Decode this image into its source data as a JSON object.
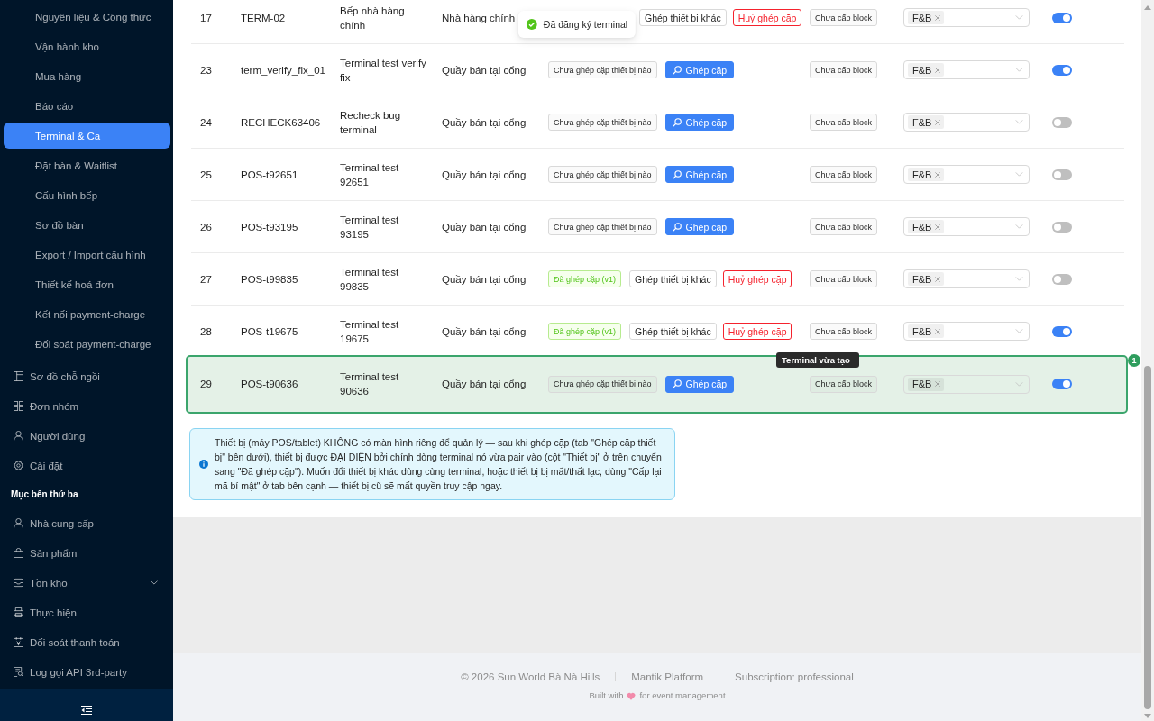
{
  "sidebar": {
    "items": [
      {
        "kind": "subitem",
        "label": "Nguyên liệu & Công thức",
        "selected": false
      },
      {
        "kind": "subitem",
        "label": "Vận hành kho",
        "selected": false
      },
      {
        "kind": "subitem",
        "label": "Mua hàng",
        "selected": false
      },
      {
        "kind": "subitem",
        "label": "Báo cáo",
        "selected": false
      },
      {
        "kind": "subitem",
        "label": "Terminal & Ca",
        "selected": true
      },
      {
        "kind": "subitem",
        "label": "Đặt bàn & Waitlist",
        "selected": false
      },
      {
        "kind": "subitem",
        "label": "Cấu hình bếp",
        "selected": false
      },
      {
        "kind": "subitem",
        "label": "Sơ đồ bàn",
        "selected": false
      },
      {
        "kind": "subitem",
        "label": "Export / Import cấu hình",
        "selected": false
      },
      {
        "kind": "subitem",
        "label": "Thiết kế hoá đơn",
        "selected": false
      },
      {
        "kind": "subitem",
        "label": "Kết nối payment-charge",
        "selected": false
      },
      {
        "kind": "subitem",
        "label": "Đối soát payment-charge",
        "selected": false
      },
      {
        "kind": "item",
        "label": "Sơ đồ chỗ ngồi",
        "selected": false
      },
      {
        "kind": "item",
        "label": "Đơn nhóm",
        "selected": false
      },
      {
        "kind": "item",
        "label": "Người dùng",
        "selected": false
      },
      {
        "kind": "item",
        "label": "Cài đặt",
        "selected": false
      },
      {
        "kind": "heading",
        "label": "Mục bên thứ ba"
      },
      {
        "kind": "item",
        "label": "Nhà cung cấp",
        "selected": false
      },
      {
        "kind": "item",
        "label": "Sản phẩm",
        "selected": false
      },
      {
        "kind": "item",
        "label": "Tồn kho",
        "selected": false,
        "expanded": false
      },
      {
        "kind": "item",
        "label": "Thực hiện",
        "selected": false
      },
      {
        "kind": "item",
        "label": "Đối soát thanh toán",
        "selected": false
      },
      {
        "kind": "item",
        "label": "Log gọi API 3rd-party",
        "selected": false
      }
    ]
  },
  "toast": {
    "kind": "success",
    "message": "Đã đăng ký terminal"
  },
  "table": {
    "rows": [
      {
        "no": "17",
        "code": "TERM-02",
        "name": "Bếp nhà hàng chính",
        "location": "Nhà hàng chính",
        "device": {
          "actions": [
            {
              "kind": "pair_other",
              "label": "Ghép thiết bị khác"
            },
            {
              "kind": "unpair",
              "label": "Huỷ ghép cặp"
            }
          ]
        },
        "block": "Chưa cấp block",
        "types": [
          "F&B"
        ],
        "active": true,
        "highlighted": false
      },
      {
        "no": "23",
        "code": "term_verify_fix_01",
        "name": "Terminal test verify fix",
        "location": "Quầy bán tại cổng",
        "device": {
          "status": {
            "kind": "unpaired",
            "label": "Chưa ghép cặp thiết bị nào"
          },
          "actions": [
            {
              "kind": "pair",
              "label": "Ghép cặp"
            }
          ]
        },
        "block": "Chưa cấp block",
        "types": [
          "F&B"
        ],
        "active": true,
        "highlighted": false
      },
      {
        "no": "24",
        "code": "RECHECK63406",
        "name": "Recheck bug terminal",
        "location": "Quầy bán tại cổng",
        "device": {
          "status": {
            "kind": "unpaired",
            "label": "Chưa ghép cặp thiết bị nào"
          },
          "actions": [
            {
              "kind": "pair",
              "label": "Ghép cặp"
            }
          ]
        },
        "block": "Chưa cấp block",
        "types": [
          "F&B"
        ],
        "active": false,
        "highlighted": false
      },
      {
        "no": "25",
        "code": "POS-t92651",
        "name": "Terminal test 92651",
        "location": "Quầy bán tại cổng",
        "device": {
          "status": {
            "kind": "unpaired",
            "label": "Chưa ghép cặp thiết bị nào"
          },
          "actions": [
            {
              "kind": "pair",
              "label": "Ghép cặp"
            }
          ]
        },
        "block": "Chưa cấp block",
        "types": [
          "F&B"
        ],
        "active": false,
        "highlighted": false
      },
      {
        "no": "26",
        "code": "POS-t93195",
        "name": "Terminal test 93195",
        "location": "Quầy bán tại cổng",
        "device": {
          "status": {
            "kind": "unpaired",
            "label": "Chưa ghép cặp thiết bị nào"
          },
          "actions": [
            {
              "kind": "pair",
              "label": "Ghép cặp"
            }
          ]
        },
        "block": "Chưa cấp block",
        "types": [
          "F&B"
        ],
        "active": false,
        "highlighted": false
      },
      {
        "no": "27",
        "code": "POS-t99835",
        "name": "Terminal test 99835",
        "location": "Quầy bán tại cổng",
        "device": {
          "status": {
            "kind": "paired",
            "label": "Đã ghép cặp (v1)"
          },
          "actions": [
            {
              "kind": "pair_other",
              "label": "Ghép thiết bị khác"
            },
            {
              "kind": "unpair",
              "label": "Huỷ ghép cặp"
            }
          ]
        },
        "block": "Chưa cấp block",
        "types": [
          "F&B"
        ],
        "active": false,
        "highlighted": false
      },
      {
        "no": "28",
        "code": "POS-t19675",
        "name": "Terminal test 19675",
        "location": "Quầy bán tại cổng",
        "device": {
          "status": {
            "kind": "paired",
            "label": "Đã ghép cặp (v1)"
          },
          "actions": [
            {
              "kind": "pair_other",
              "label": "Ghép thiết bị khác"
            },
            {
              "kind": "unpair",
              "label": "Huỷ ghép cặp"
            }
          ]
        },
        "block": "Chưa cấp block",
        "types": [
          "F&B"
        ],
        "active": true,
        "highlighted": false
      },
      {
        "no": "29",
        "code": "POS-t90636",
        "name": "Terminal test 90636",
        "location": "Quầy bán tại cổng",
        "device": {
          "status": {
            "kind": "unpaired",
            "label": "Chưa ghép cặp thiết bị nào"
          },
          "actions": [
            {
              "kind": "pair",
              "label": "Ghép cặp"
            }
          ]
        },
        "block": "Chưa cấp block",
        "types": [
          "F&B"
        ],
        "active": true,
        "highlighted": true,
        "callout": {
          "label": "Terminal vừa tạo",
          "step": "1"
        }
      }
    ]
  },
  "info_alert": {
    "text": "Thiết bị (máy POS/tablet) KHÔNG có màn hình riêng để quản lý — sau khi ghép cặp (tab \"Ghép cặp thiết bị\" bên dưới), thiết bị được ĐẠI DIỆN bởi chính dòng terminal nó vừa pair vào (cột \"Thiết bị\" ở trên chuyển sang \"Đã ghép cặp\"). Muốn đổi thiết bị khác dùng cùng terminal, hoặc thiết bị bị mất/thất lạc, dùng \"Cấp lại mã bí mật\" ở tab bên cạnh — thiết bị cũ sẽ mất quyền truy cập ngay."
  },
  "footer": {
    "items": [
      "© 2026 Sun World Bà Nà Hills",
      "Mantik Platform",
      "Subscription: professional"
    ],
    "built_with": {
      "before": "Built with",
      "after": "for event management"
    }
  }
}
